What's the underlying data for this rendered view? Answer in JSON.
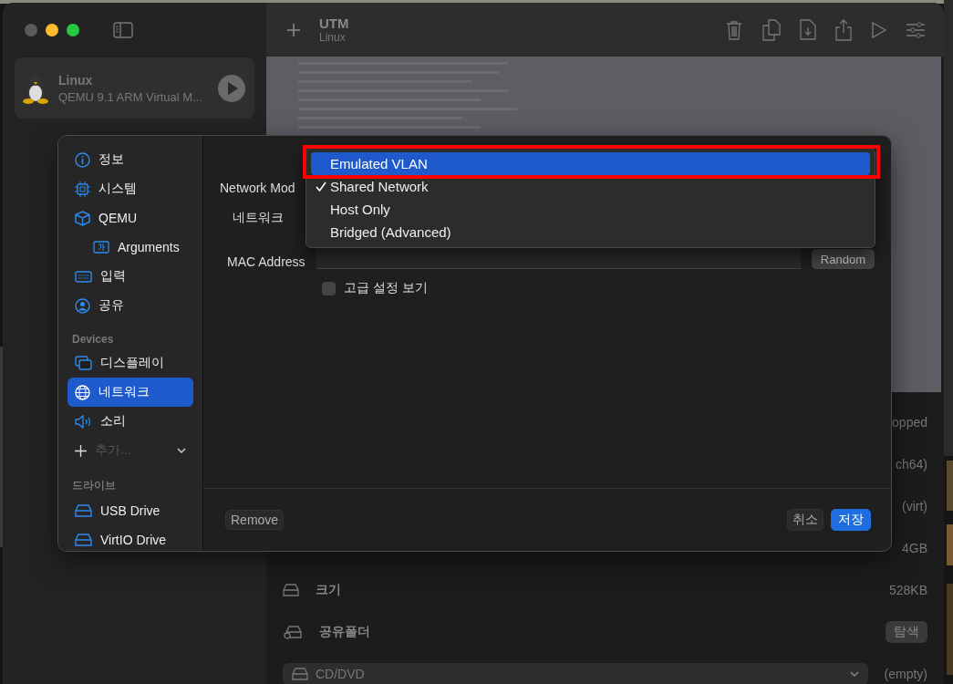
{
  "toolbar": {
    "title": "UTM",
    "subtitle": "Linux"
  },
  "vm_list": [
    {
      "name": "Linux",
      "description": "QEMU 9.1 ARM Virtual M...",
      "selected": true
    }
  ],
  "details": {
    "rows": [
      {
        "kind": "text",
        "value": "opped"
      },
      {
        "kind": "text",
        "value": "ch64)"
      },
      {
        "kind": "text",
        "value": "(virt)"
      },
      {
        "kind": "text",
        "value": "4GB"
      },
      {
        "kind": "text",
        "label": "크기",
        "value": "528KB"
      },
      {
        "kind": "button",
        "label": "공유폴더",
        "value": "탐색"
      }
    ],
    "drive_select": {
      "value": "CD/DVD",
      "status": "(empty)"
    }
  },
  "dialog": {
    "general": [
      {
        "label": "정보",
        "selected": false
      },
      {
        "label": "시스템",
        "selected": false
      },
      {
        "label": "QEMU",
        "selected": false,
        "children": [
          {
            "label": "Arguments",
            "selected": false
          }
        ]
      },
      {
        "label": "입력",
        "selected": false
      },
      {
        "label": "공유",
        "selected": false
      }
    ],
    "devices": {
      "heading": "Devices",
      "items": [
        {
          "label": "디스플레이",
          "selected": false
        },
        {
          "label": "네트워크",
          "selected": true
        },
        {
          "label": "소리",
          "selected": false
        }
      ]
    },
    "add": {
      "label": "추가..."
    },
    "drives": {
      "heading": "드라이브",
      "items": [
        {
          "label": "USB Drive",
          "selected": false
        },
        {
          "label": "VirtIO Drive",
          "selected": false
        }
      ]
    },
    "form": {
      "network_mode_label": "Network Mod",
      "card_label": "네트워크",
      "mac_label": "MAC Address",
      "random_button": "Random",
      "advanced": {
        "label": "고급 설정 보기",
        "checked": false
      }
    },
    "menu": [
      {
        "label": "Emulated VLAN",
        "highlighted": true,
        "checked": false,
        "annotated": true
      },
      {
        "label": "Shared Network",
        "highlighted": false,
        "checked": true,
        "annotated": false
      },
      {
        "label": "Host Only",
        "highlighted": false,
        "checked": false,
        "annotated": false
      },
      {
        "label": "Bridged (Advanced)",
        "highlighted": false,
        "checked": false,
        "annotated": false
      }
    ],
    "footer": {
      "remove": "Remove",
      "cancel": "취소",
      "save": "저장"
    }
  }
}
